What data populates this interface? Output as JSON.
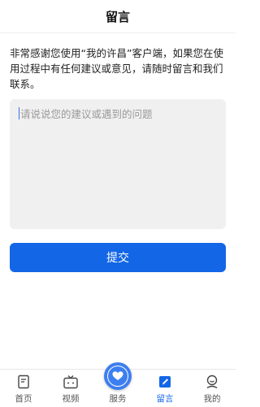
{
  "header": {
    "title": "留言"
  },
  "intro": {
    "text": "非常感谢您使用“我的许昌”客户端，如果您在使用过程中有任何建议或意见，请随时留言和我们联系。"
  },
  "feedback": {
    "value": "",
    "placeholder": "请说说您的建议或遇到的问题"
  },
  "submit": {
    "label": "提交"
  },
  "tabbar": {
    "items": [
      {
        "label": "首页",
        "icon": "home-doc-icon",
        "active": false
      },
      {
        "label": "视频",
        "icon": "tv-icon",
        "active": false
      },
      {
        "label": "服务",
        "icon": "heart-hand-icon",
        "active": false
      },
      {
        "label": "留言",
        "icon": "edit-icon",
        "active": true
      },
      {
        "label": "我的",
        "icon": "user-icon",
        "active": false
      }
    ]
  },
  "colors": {
    "accent": "#1366e6",
    "center_button": "#3d7ef0",
    "input_bg": "#f0f0f0"
  }
}
